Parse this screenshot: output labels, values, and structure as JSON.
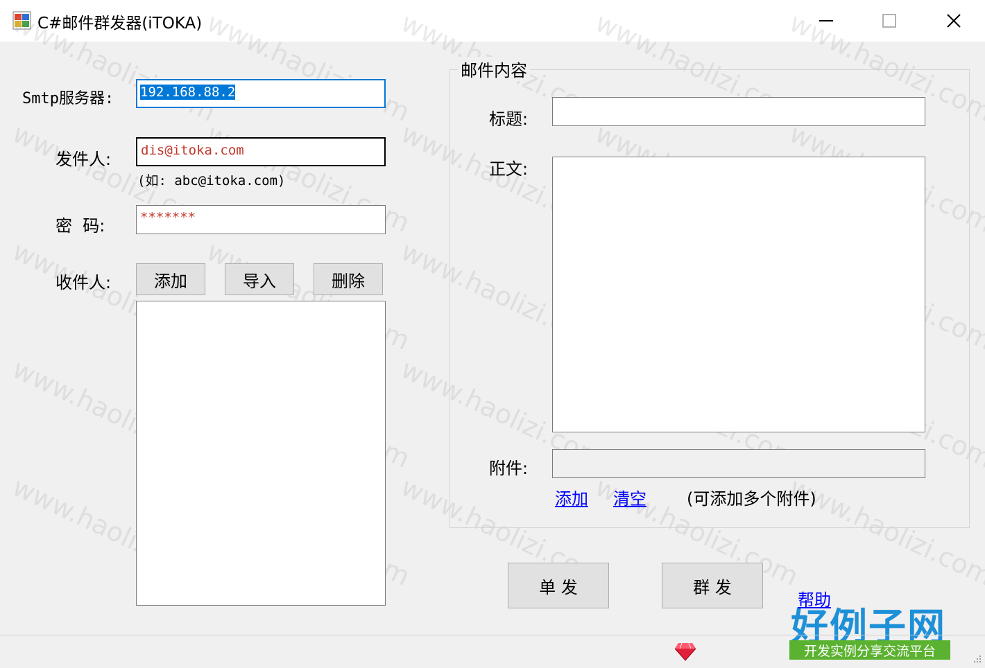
{
  "window": {
    "title": "C#邮件群发器(iTOKA)"
  },
  "left": {
    "smtp_label": "Smtp服务器:",
    "smtp_value": "192.168.88.2",
    "sender_label": "发件人:",
    "sender_value": "dis@itoka.com",
    "sender_hint": "(如: abc@itoka.com)",
    "password_label": "密  码:",
    "password_value": "*******",
    "recipients_label": "收件人:",
    "add_button": "添加",
    "import_button": "导入",
    "delete_button": "删除",
    "recipients_list": []
  },
  "mail": {
    "group_title": "邮件内容",
    "subject_label": "标题:",
    "subject_value": "",
    "body_label": "正文:",
    "body_value": "",
    "attachment_label": "附件:",
    "attachment_value": "",
    "add_link": "添加",
    "clear_link": "清空",
    "attachment_hint": "(可添加多个附件)"
  },
  "actions": {
    "single_send": "单 发",
    "group_send": "群 发",
    "help_link": "帮助"
  },
  "branding": {
    "logo_text": "好例子网",
    "logo_subtext": "开发实例分享交流平台",
    "watermark": "www.haolizi.com"
  },
  "colors": {
    "focus_border": "#0078d7",
    "link": "#0000ff",
    "input_text": "#c0392b",
    "logo_blue": "#1e90d8",
    "logo_green": "#5bb230"
  }
}
